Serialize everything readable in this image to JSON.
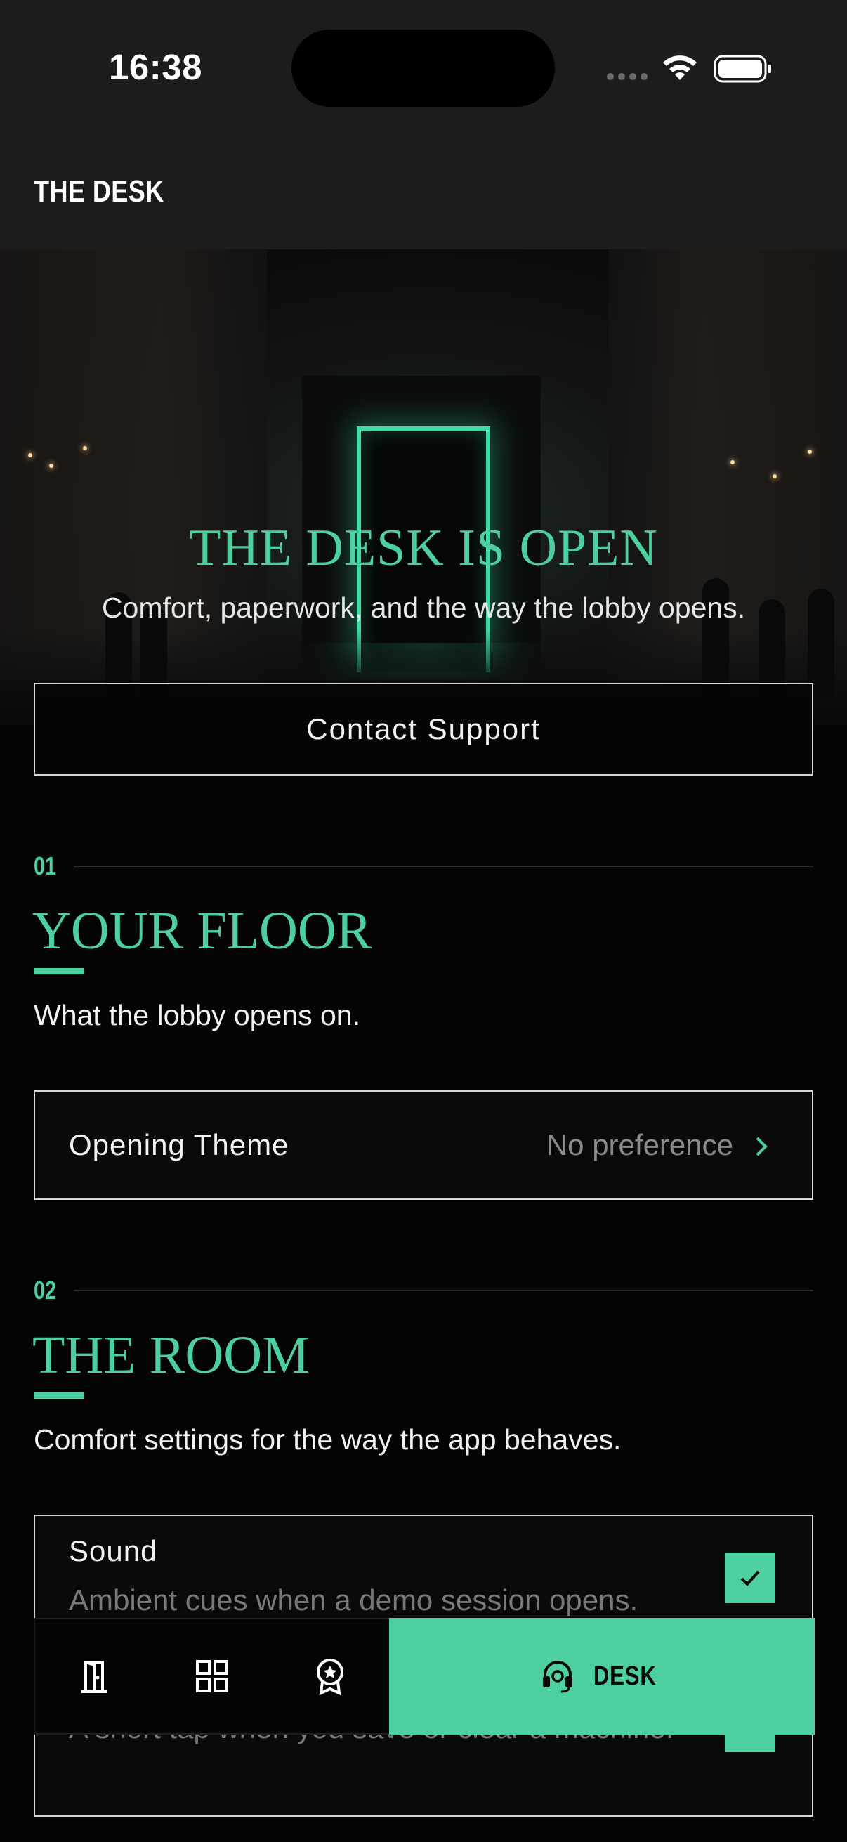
{
  "status_bar": {
    "time": "16:38"
  },
  "header": {
    "title": "THE DESK"
  },
  "hero": {
    "title": "THE DESK IS OPEN",
    "subtitle": "Comfort, paperwork, and the way the lobby opens."
  },
  "support_button": {
    "label": "Contact Support"
  },
  "sections": [
    {
      "number": "01",
      "title": "YOUR FLOOR",
      "description": "What the lobby opens on.",
      "rows": [
        {
          "label": "Opening Theme",
          "value": "No preference"
        }
      ]
    },
    {
      "number": "02",
      "title": "THE ROOM",
      "description": "Comfort settings for the way the app behaves.",
      "toggles": [
        {
          "title": "Sound",
          "description": "Ambient cues when a demo session opens.",
          "checked": true
        },
        {
          "title": "",
          "description": "A short tap when you save or clear a machine.",
          "checked": true
        }
      ]
    }
  ],
  "tab_bar": {
    "tabs": [
      {
        "icon": "door-icon"
      },
      {
        "icon": "grid-icon"
      },
      {
        "icon": "badge-icon"
      },
      {
        "icon": "headset-icon",
        "label": "DESK",
        "active": true
      }
    ]
  },
  "colors": {
    "accent": "#4ecf9f",
    "background": "#050505",
    "header": "#1c1c1c"
  }
}
